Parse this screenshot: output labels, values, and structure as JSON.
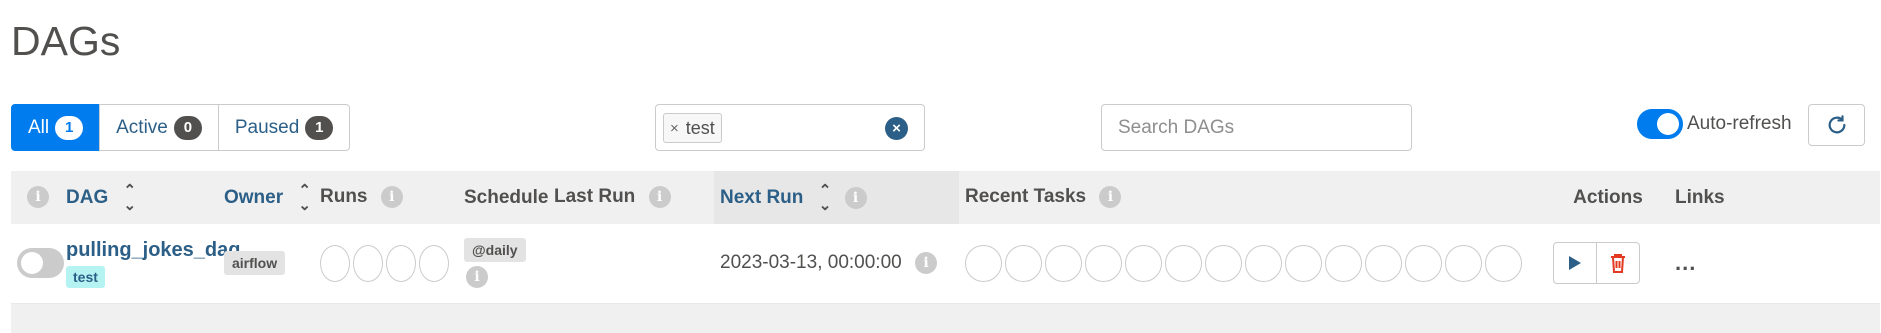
{
  "page": {
    "title": "DAGs"
  },
  "status_filter": {
    "all": {
      "label": "All",
      "count": "1"
    },
    "active": {
      "label": "Active",
      "count": "0"
    },
    "paused": {
      "label": "Paused",
      "count": "1"
    },
    "selected": "all"
  },
  "tag_filter": {
    "tags": [
      "test"
    ],
    "remove_glyph": "×",
    "clear_glyph": "×"
  },
  "search": {
    "placeholder": "Search DAGs",
    "value": ""
  },
  "auto_refresh": {
    "label": "Auto-refresh",
    "enabled": true
  },
  "table": {
    "headers": {
      "info": "i",
      "dag": "DAG",
      "owner": "Owner",
      "runs": "Runs",
      "schedule": "Schedule",
      "last_run": "Last Run",
      "next_run": "Next Run",
      "recent_tasks": "Recent Tasks",
      "actions": "Actions",
      "links": "Links"
    },
    "rows": [
      {
        "dag_id": "pulling_jokes_dag",
        "tag": "test",
        "owner": "airflow",
        "runs_circles": 4,
        "schedule": "@daily",
        "last_run": "",
        "next_run": "2023-03-13, 00:00:00",
        "recent_task_circles": 14,
        "paused": true,
        "links_glyph": "..."
      }
    ]
  },
  "colors": {
    "primary": "#017cee",
    "link": "#2c5f87",
    "delete": "#e43921",
    "tag_bg": "#b5f3f3",
    "header_bg": "#f0f0f0"
  },
  "icons": {
    "sort": "sort-arrows-icon",
    "info": "info-icon",
    "refresh": "refresh-icon",
    "play": "play-icon",
    "delete": "trash-icon",
    "links": "ellipsis-icon"
  }
}
